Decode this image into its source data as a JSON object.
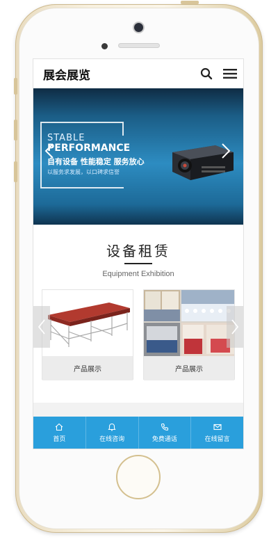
{
  "header": {
    "logo": "展会展览"
  },
  "banner": {
    "line1": "STABLE",
    "line2": "PERFORMANCE",
    "line3": "自有设备   性能稳定   服务放心",
    "line4": "以服务求发展，以口碑求信誉"
  },
  "section": {
    "title_cn": "设备租赁",
    "title_en": "Equipment Exhibition"
  },
  "products": [
    {
      "label": "产品展示"
    },
    {
      "label": "产品展示"
    }
  ],
  "bottom_nav": [
    {
      "label": "首页",
      "icon": "home-icon"
    },
    {
      "label": "在线咨询",
      "icon": "chat-icon"
    },
    {
      "label": "免费通话",
      "icon": "phone-icon"
    },
    {
      "label": "在线留言",
      "icon": "mail-icon"
    }
  ],
  "colors": {
    "accent": "#2a9fdc",
    "banner": "#1b5d86"
  }
}
